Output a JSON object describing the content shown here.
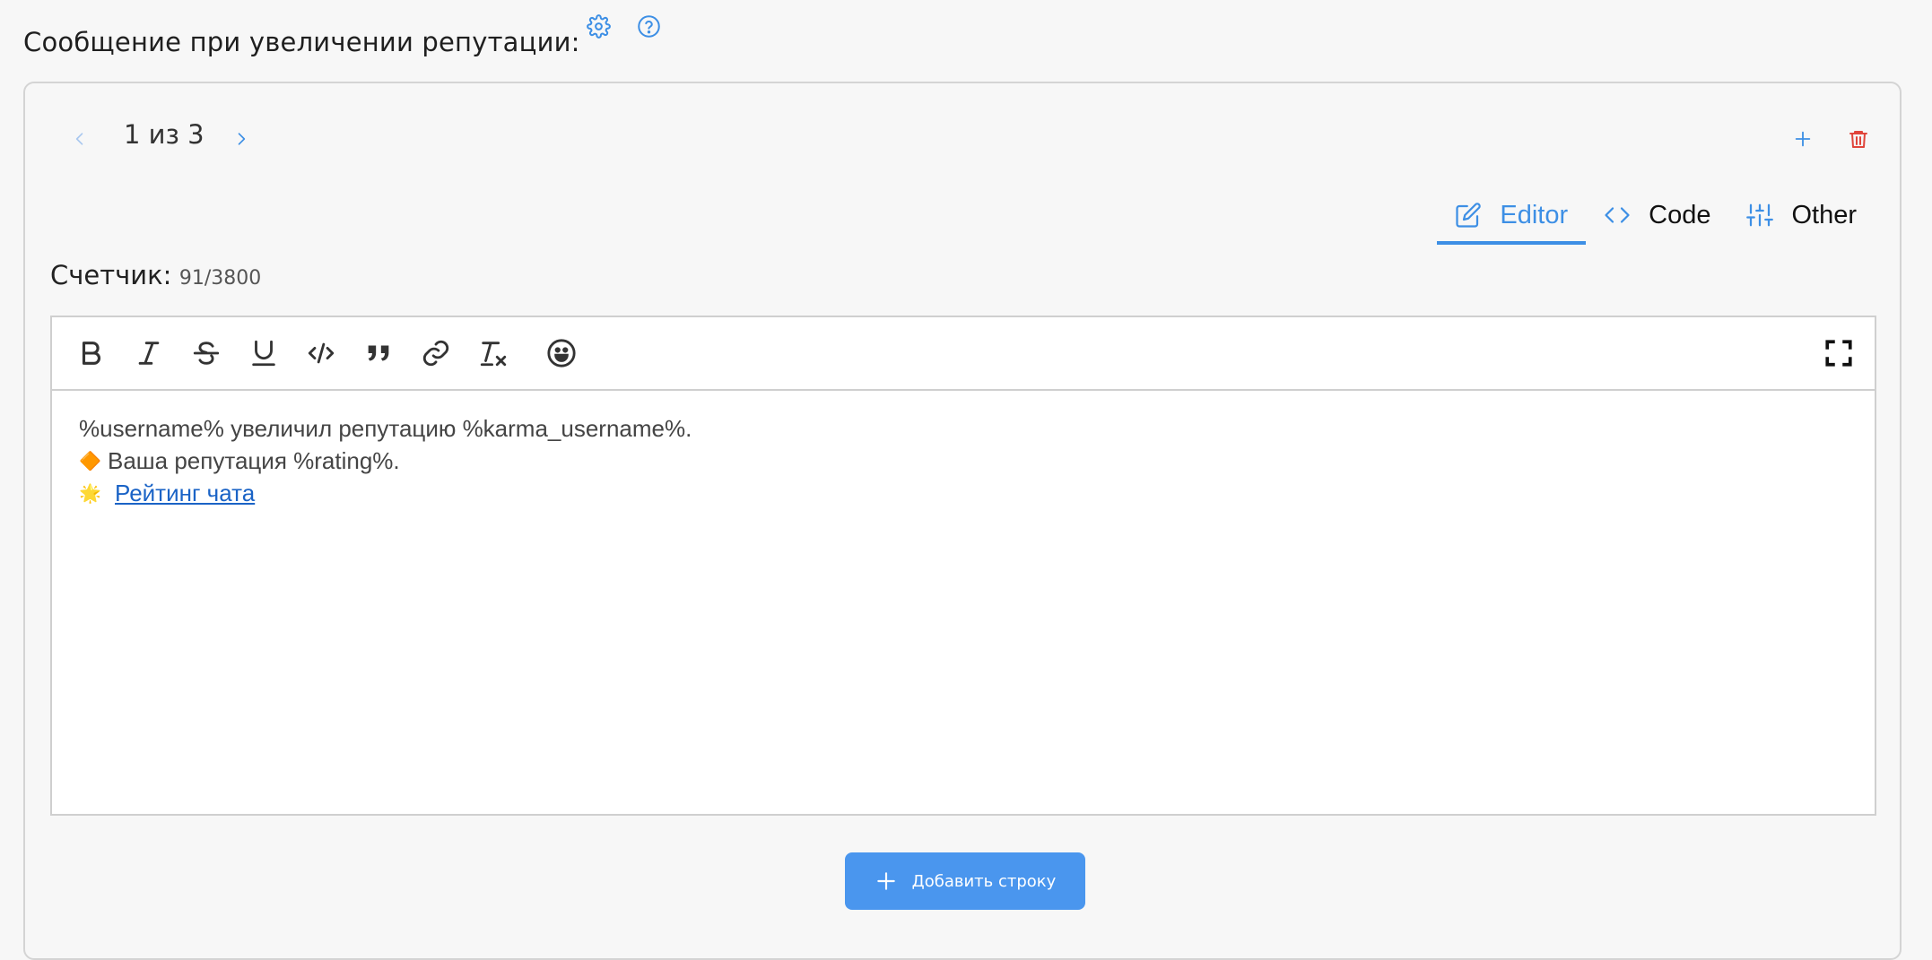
{
  "title": "Сообщение при увеличении репутации:",
  "icons": {
    "settings": "gear-icon",
    "help": "question-circle-icon"
  },
  "pager": {
    "text": "1 из 3"
  },
  "tabs": [
    {
      "label": "Editor",
      "icon": "edit-icon",
      "active": true
    },
    {
      "label": "Code",
      "icon": "code-icon",
      "active": false
    },
    {
      "label": "Other",
      "icon": "sliders-icon",
      "active": false
    }
  ],
  "counter": {
    "label": "Счетчик:",
    "value": "91/3800"
  },
  "editor": {
    "toolbar": [
      "bold",
      "italic",
      "strikethrough",
      "underline",
      "code",
      "quote",
      "link",
      "clear-format",
      "emoji",
      "fullscreen"
    ],
    "lines": [
      {
        "emoji": "",
        "text": "%username% увеличил репутацию %karma_username%."
      },
      {
        "emoji": "🔶",
        "text": "Ваша репутация %rating%."
      },
      {
        "emoji": "🌟",
        "link": "Рейтинг чата"
      }
    ]
  },
  "add_row": {
    "label": "Добавить строку"
  },
  "colors": {
    "accent": "#3d8fe5",
    "danger": "#e0453b",
    "button": "#4a96ee"
  }
}
